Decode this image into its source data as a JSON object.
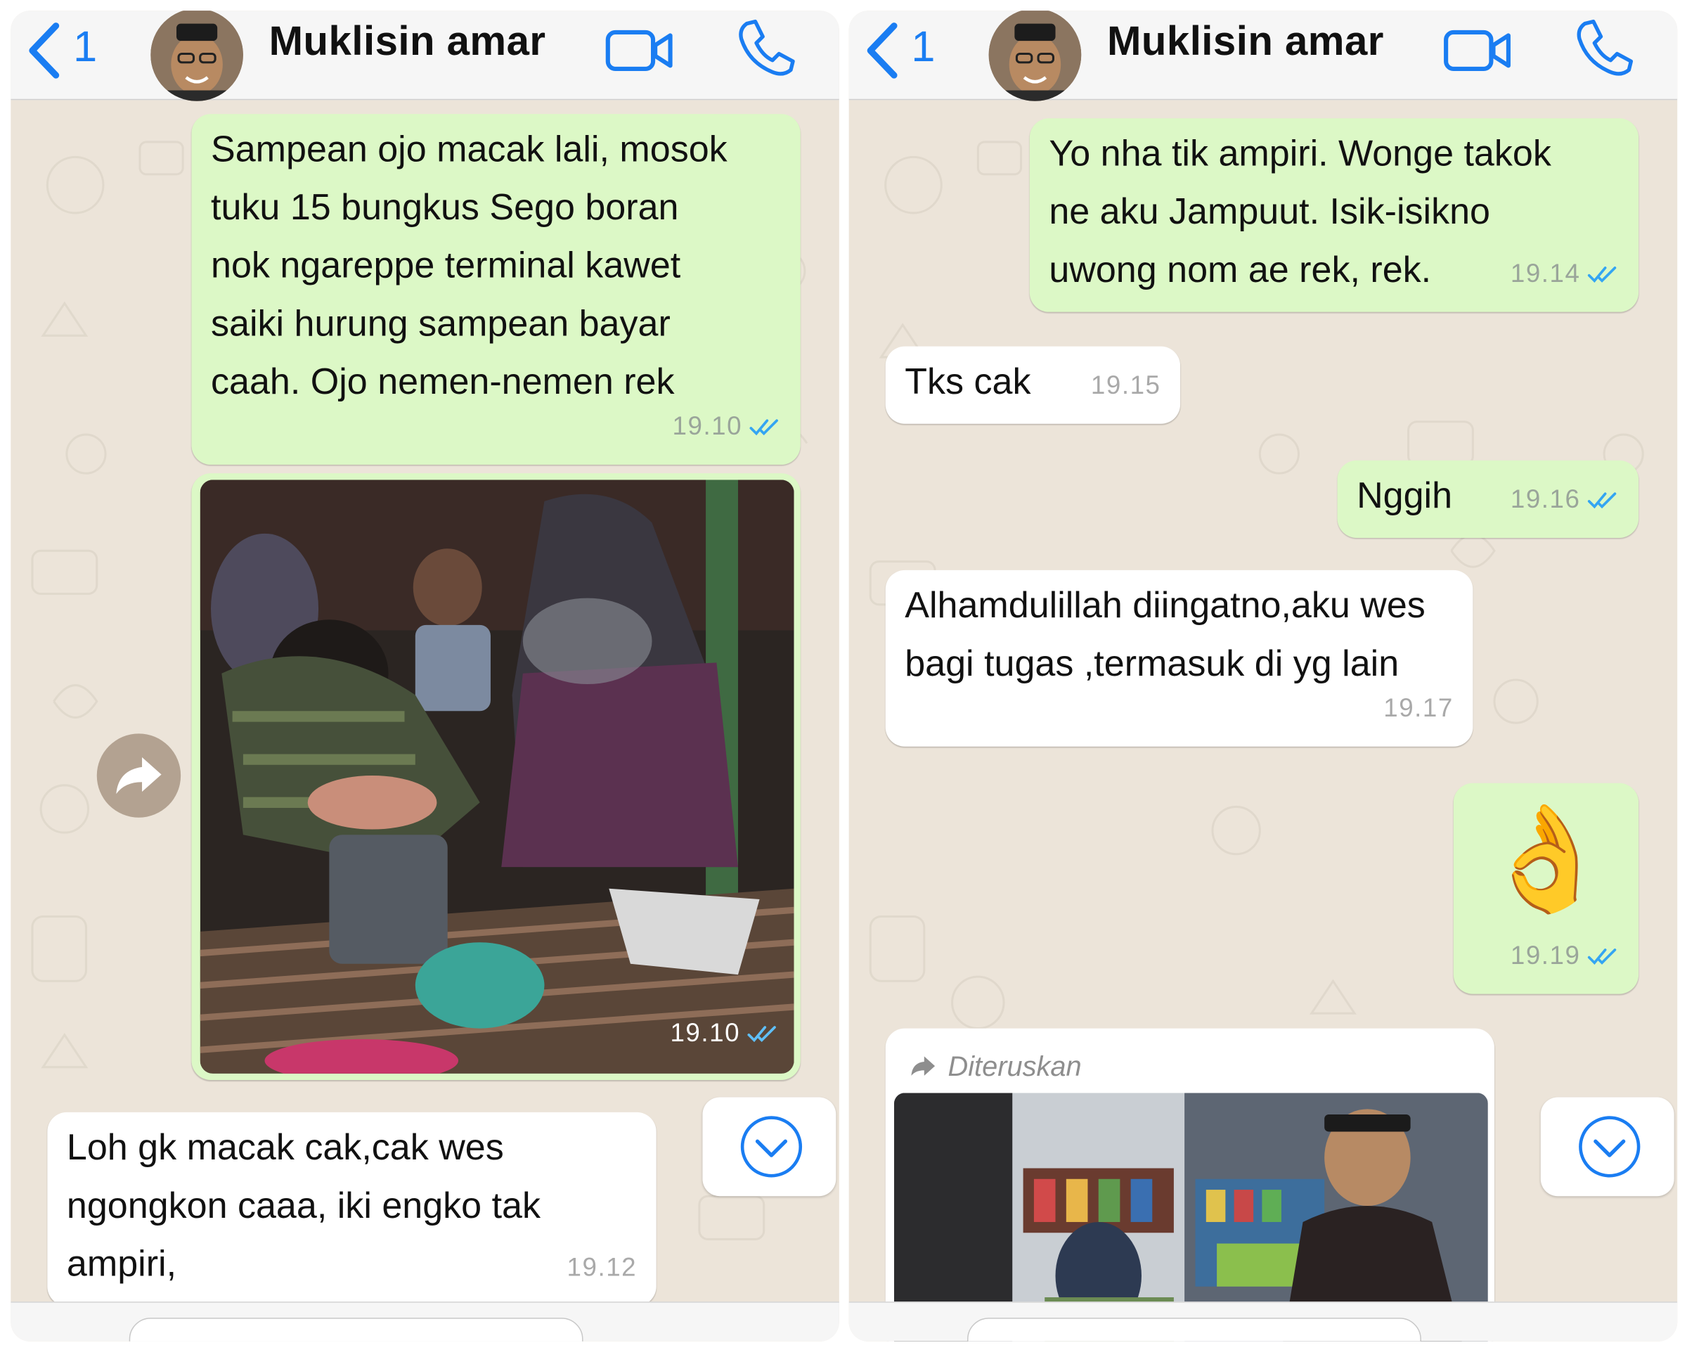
{
  "colors": {
    "accent": "#1a7df2",
    "outgoing": "#dcf8c6",
    "incoming": "#ffffff",
    "chat_bg": "#ece4d9",
    "read_ticks": "#34a5f2"
  },
  "left": {
    "header": {
      "back_count": "1",
      "contact_name": "Muklisin amar",
      "icons": [
        "chevron-left-icon",
        "avatar",
        "video-call-icon",
        "phone-icon"
      ]
    },
    "messages": [
      {
        "direction": "out",
        "text": "Sampean ojo macak lali, mosok\ntuku 15 bungkus Sego boran\nnok ngareppe terminal kawet\nsaiki hurung sampean bayar\ncaah. Ojo nemen-nemen rek",
        "time": "19.10",
        "read": true
      },
      {
        "direction": "out",
        "type": "photo",
        "time": "19.10",
        "read": true
      },
      {
        "direction": "in",
        "text": "Loh gk macak cak,cak wes\nngongkon caaa, iki engko tak\nampiri,",
        "time": "19.12"
      }
    ]
  },
  "right": {
    "header": {
      "back_count": "1",
      "contact_name": "Muklisin amar",
      "icons": [
        "chevron-left-icon",
        "avatar",
        "video-call-icon",
        "phone-icon"
      ]
    },
    "messages": [
      {
        "direction": "out",
        "text": "Yo nha tik ampiri. Wonge takok\nne aku Jampuut. Isik-isikno\nuwong nom ae rek, rek.",
        "time": "19.14",
        "read": true
      },
      {
        "direction": "in",
        "text": "Tks cak",
        "time": "19.15"
      },
      {
        "direction": "out",
        "text": "Nggih",
        "time": "19.16",
        "read": true
      },
      {
        "direction": "in",
        "text": "Alhamdulillah diingatno,aku wes\nbagi tugas ,termasuk di yg lain",
        "time": "19.17"
      },
      {
        "direction": "out",
        "type": "emoji",
        "text": "👌",
        "time": "19.19",
        "read": true
      },
      {
        "direction": "in",
        "type": "forwarded-photo",
        "forward_label": "Diteruskan"
      }
    ]
  }
}
